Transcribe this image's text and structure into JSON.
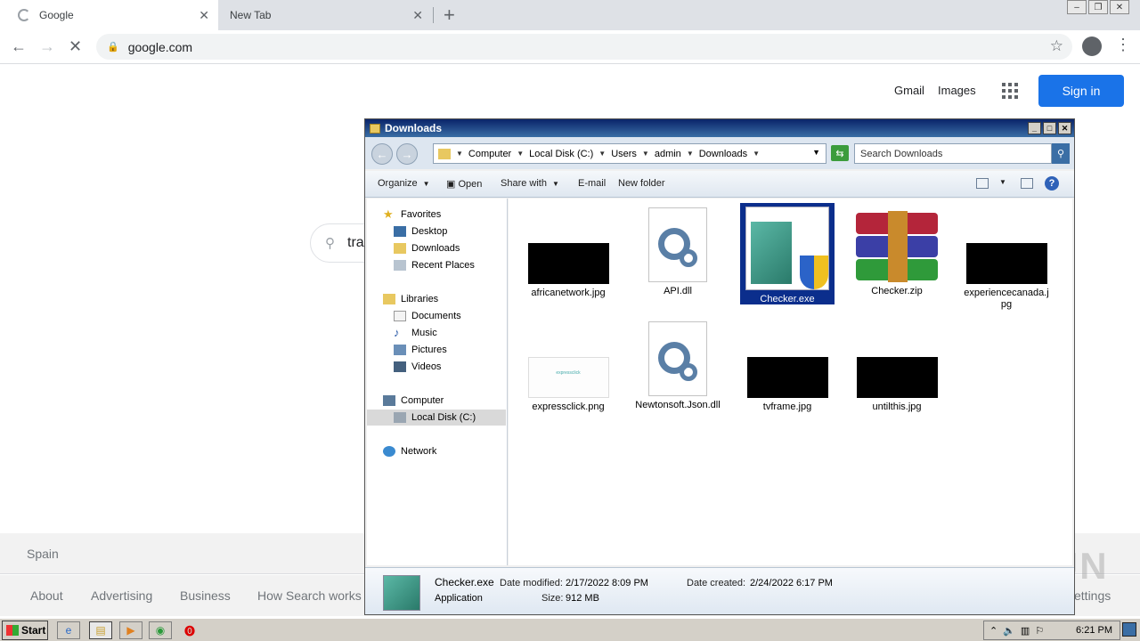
{
  "browser": {
    "tabs": [
      {
        "title": "Google",
        "active": true
      },
      {
        "title": "New Tab",
        "active": false
      }
    ],
    "url": "google.com"
  },
  "google": {
    "header_links": [
      "Gmail",
      "Images"
    ],
    "sign_in": "Sign in",
    "search_text": "tra",
    "country": "Spain",
    "footer_links": [
      "About",
      "Advertising",
      "Business",
      "How Search works"
    ],
    "footer_right": "ettings"
  },
  "explorer": {
    "title": "Downloads",
    "breadcrumb": [
      "Computer",
      "Local Disk (C:)",
      "Users",
      "admin",
      "Downloads"
    ],
    "search_placeholder": "Search Downloads",
    "commands": [
      "Organize",
      "Open",
      "Share with",
      "E-mail",
      "New folder"
    ],
    "nav": {
      "favorites": "Favorites",
      "favorites_items": [
        "Desktop",
        "Downloads",
        "Recent Places"
      ],
      "libraries": "Libraries",
      "libraries_items": [
        "Documents",
        "Music",
        "Pictures",
        "Videos"
      ],
      "computer": "Computer",
      "computer_items": [
        "Local Disk (C:)"
      ],
      "network": "Network"
    },
    "files": [
      {
        "name": "africanetwork.jpg",
        "type": "jpg"
      },
      {
        "name": "API.dll",
        "type": "dll"
      },
      {
        "name": "Checker.exe",
        "type": "exe",
        "selected": true
      },
      {
        "name": "Checker.zip",
        "type": "zip"
      },
      {
        "name": "experiencecanada.jpg",
        "type": "jpg"
      },
      {
        "name": "expressclick.png",
        "type": "png"
      },
      {
        "name": "Newtonsoft.Json.dll",
        "type": "dll"
      },
      {
        "name": "tvframe.jpg",
        "type": "jpg"
      },
      {
        "name": "untilthis.jpg",
        "type": "jpg"
      }
    ],
    "png_thumb_text": "expressclick",
    "details": {
      "name": "Checker.exe",
      "type": "Application",
      "modified_label": "Date modified:",
      "modified": "2/17/2022 8:09 PM",
      "created_label": "Date created:",
      "created": "2/24/2022 6:17 PM",
      "size_label": "Size:",
      "size": "912 MB"
    }
  },
  "taskbar": {
    "start": "Start",
    "clock": "6:21 PM"
  },
  "watermark": "ANY RUN"
}
